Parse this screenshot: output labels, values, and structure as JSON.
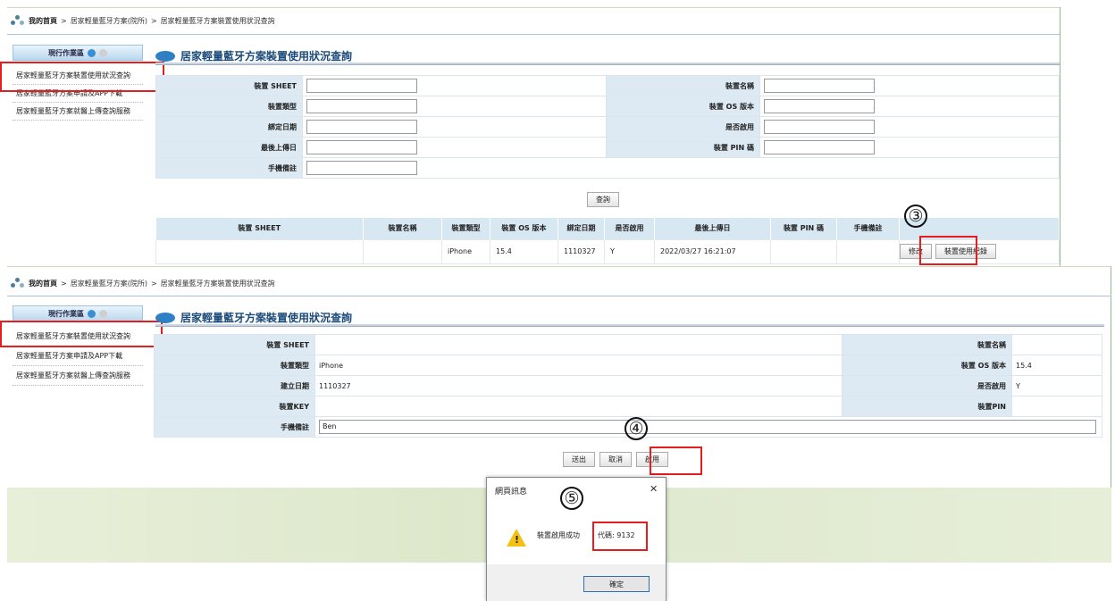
{
  "top": {
    "breadcrumb": {
      "home": "我的首頁",
      "sep": ">",
      "level1": "居家輕量藍牙方案(院所)",
      "level2": "居家輕量藍牙方案裝置使用狀況查詢"
    },
    "sidebar": {
      "header": "現行作業區",
      "items": [
        "居家輕量藍牙方案裝置使用狀況查詢",
        "居家輕量藍牙方案申請及APP下載",
        "居家輕量藍牙方案就醫上傳查詢服務"
      ]
    },
    "page_title": "居家輕量藍牙方案裝置使用狀況查詢",
    "form": {
      "sheet_label": "裝置 SHEET",
      "type_label": "裝置類型",
      "bind_date_label": "綁定日期",
      "last_upload_label": "最後上傳日",
      "note_label": "手機備註",
      "name_label": "裝置名稱",
      "os_label": "裝置 OS 版本",
      "enabled_label": "是否啟用",
      "pin_label": "裝置 PIN 碼"
    },
    "query_button": "查詢",
    "results": {
      "headers": [
        "裝置 SHEET",
        "裝置名稱",
        "裝置類型",
        "裝置 OS 版本",
        "綁定日期",
        "是否啟用",
        "最後上傳日",
        "裝置 PIN 碼",
        "手機備註"
      ],
      "row": {
        "sheet": "",
        "name": "",
        "type": "iPhone",
        "os": "15.4",
        "bind_date": "1110327",
        "enabled": "Y",
        "last_upload": "2022/03/27 16:21:07",
        "pin": "",
        "note": ""
      },
      "edit_button": "修改",
      "history_button": "裝置使用紀錄"
    }
  },
  "bottom": {
    "breadcrumb": {
      "home": "我的首頁",
      "sep": ">",
      "level1": "居家輕量藍牙方案(院所)",
      "level2": "居家輕量藍牙方案裝置使用狀況查詢"
    },
    "sidebar": {
      "header": "現行作業區",
      "items": [
        "居家輕量藍牙方案裝置使用狀況查詢",
        "居家輕量藍牙方案申請及APP下載",
        "居家輕量藍牙方案就醫上傳查詢服務"
      ]
    },
    "page_title": "居家輕量藍牙方案裝置使用狀況查詢",
    "detail": {
      "sheet_label": "裝置 SHEET",
      "sheet_value": "",
      "type_label": "裝置類型",
      "type_value": "iPhone",
      "created_label": "建立日期",
      "created_value": "1110327",
      "key_label": "裝置KEY",
      "key_value": "",
      "note_label": "手機備註",
      "note_value": "Ben",
      "name_label": "裝置名稱",
      "name_value": "",
      "os_label": "裝置 OS 版本",
      "os_value": "15.4",
      "enabled_label": "是否啟用",
      "enabled_value": "Y",
      "pin_label": "裝置PIN",
      "pin_value": ""
    },
    "buttons": {
      "submit": "送出",
      "cancel": "取消",
      "enable": "啟用"
    }
  },
  "dialog": {
    "title": "網頁訊息",
    "message": "裝置啟用成功",
    "code": "代碼: 9132",
    "ok": "確定",
    "close": "✕"
  },
  "steps": {
    "s3": "③",
    "s4": "④",
    "s5": "⑤"
  },
  "colors": {
    "highlight": "#e41e1e",
    "label_bg": "#ddeaf3",
    "title": "#1a4a7a"
  }
}
